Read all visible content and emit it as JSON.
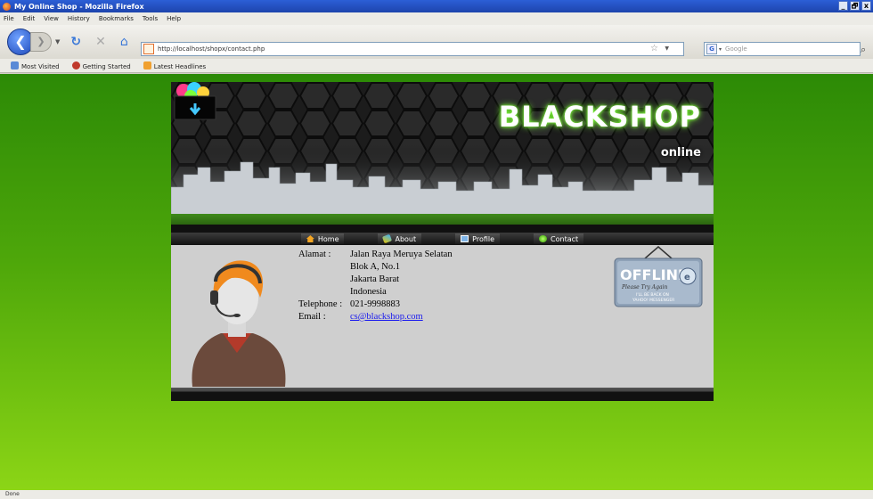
{
  "window": {
    "title": "My Online Shop - Mozilla Firefox",
    "controls": [
      "_",
      "🗗",
      "x"
    ]
  },
  "menu": [
    "File",
    "Edit",
    "View",
    "History",
    "Bookmarks",
    "Tools",
    "Help"
  ],
  "toolbar": {
    "url": "http://localhost/shopx/contact.php",
    "search_placeholder": "Google"
  },
  "bookmarks": [
    "Most Visited",
    "Getting Started",
    "Latest Headlines"
  ],
  "status_text": "Done",
  "site": {
    "brand": "BLACKSHOP",
    "brand_sub": "online",
    "nav": [
      "Home",
      "About",
      "Profile",
      "Contact"
    ],
    "contact": {
      "alamat_label": "Alamat :",
      "address_lines": [
        "Jalan Raya Meruya Selatan",
        "Blok A, No.1",
        "Jakarta Barat",
        "Indonesia"
      ],
      "telephone_label": "Telephone :",
      "telephone": "021-9998883",
      "email_label": "Email :",
      "email": "cs@blackshop.com"
    },
    "offline_badge": {
      "title": "OFFLINE",
      "tagline": "Please Try Again",
      "line1": "I'LL BE BACK ON",
      "line2": "YAHOO! MESSENGER"
    }
  }
}
